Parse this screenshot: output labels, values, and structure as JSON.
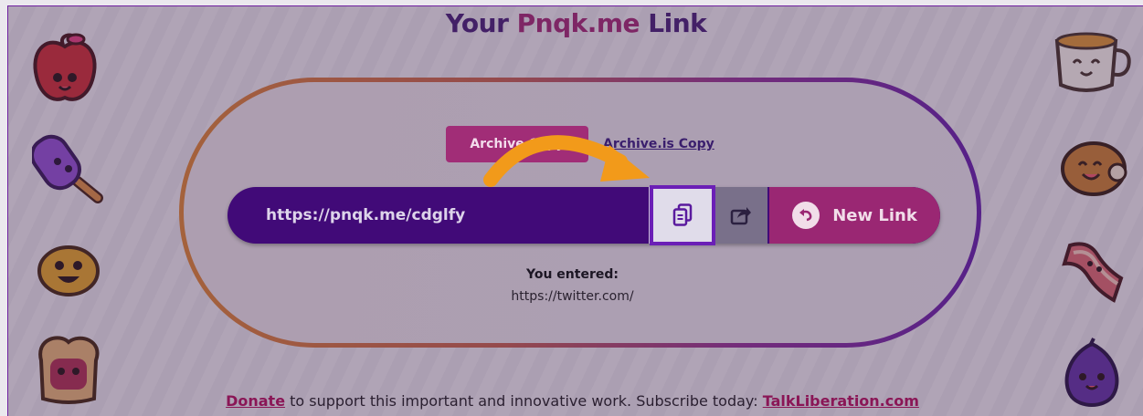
{
  "header": {
    "title_prefix": "Your ",
    "title_brand": "Pnqk.me",
    "title_suffix": " Link"
  },
  "tabs": {
    "active_label": "Archive Copy",
    "link_label": "Archive.is Copy"
  },
  "link_bar": {
    "short_url": "https://pnqk.me/cdglfy",
    "new_link_label": "New Link"
  },
  "entered": {
    "label": "You entered:",
    "value": "https://twitter.com/"
  },
  "footer": {
    "donate_label": "Donate",
    "middle_text": " to support this important and innovative work. Subscribe today: ",
    "site_link": "TalkLiberation.com"
  },
  "icons": {
    "copy": "copy-icon",
    "share": "share-icon",
    "undo": "undo-icon"
  },
  "colors": {
    "brand_purple": "#410a78",
    "accent_magenta": "#9a2773",
    "highlight_border": "#6b1fb6",
    "arrow_orange": "#f29a1a"
  }
}
